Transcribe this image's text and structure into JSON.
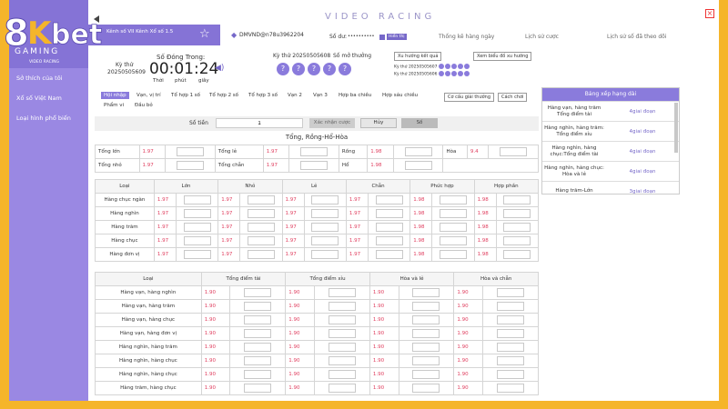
{
  "brand": {
    "logo_text": "8Kbet",
    "title": "VIDEO RACING"
  },
  "sidebar": {
    "game_label": "GAMING",
    "sub": "VIDEO RACING",
    "items": [
      "Sở thích của tôi",
      "Xổ số Việt Nam",
      "Loại hình phổ biến"
    ]
  },
  "header": {
    "breadcrumb": "Kênh số    VII Kênh Xổ số 1.5",
    "account": "DMVND@n78u3962204",
    "balance_label": "Số dư:",
    "balance_value": "••••••••••",
    "show_label": "Hiển thị",
    "links": [
      "Thống kê hàng ngày",
      "Lịch sử cược",
      "Lịch sử số đã theo dõi"
    ]
  },
  "draw": {
    "period_label": "Kỳ thứ",
    "period": "20250505609",
    "closing_label": "Số Đóng Trong:",
    "timer": "00:01:24",
    "units": [
      "Thời",
      "phút",
      "giây"
    ],
    "last_period_label": "Kỳ thứ 20250505608",
    "result_label": "Số mở thưởng",
    "balls": [
      "?",
      "?",
      "?",
      "?",
      "?"
    ],
    "trend_btn": "Xu hướng kết quả",
    "chart_btn": "Xem biểu đồ xu hướng",
    "hist1": "Kỳ thứ 20250505607",
    "hist2": "Kỳ thứ 20250505606"
  },
  "tabs": [
    "Hội nhập",
    "Vạn, vị trí",
    "Tổ hợp 1 số",
    "Tổ hợp 2 số",
    "Tổ hợp 3 số",
    "Vạn 2",
    "Vạn 3",
    "Hợp ba chiều",
    "Hợp sáu chiều",
    "Phẩm vi",
    "Đầu bỏ"
  ],
  "rule_buttons": [
    "Cơ cấu giải thưởng",
    "Cách chơi"
  ],
  "bet": {
    "amount_label": "Số tiền",
    "amount": "1",
    "confirm": "Xác nhận cược",
    "cancel": "Hủy",
    "num": "Số"
  },
  "sec1": {
    "title": "Tổng, Rồng-Hổ-Hòa",
    "rows": [
      [
        {
          "l": "Tổng lớn",
          "o": "1.97"
        },
        {
          "l": "Tổng lẻ",
          "o": "1.97"
        },
        {
          "l": "Rồng",
          "o": "1.98"
        },
        {
          "l": "Hòa",
          "o": "9.4"
        }
      ],
      [
        {
          "l": "Tổng nhỏ",
          "o": "1.97"
        },
        {
          "l": "Tổng chẵn",
          "o": "1.97"
        },
        {
          "l": "Hổ",
          "o": "1.98"
        }
      ]
    ]
  },
  "sec2": {
    "headers": [
      "Loại",
      "Lớn",
      "Nhỏ",
      "Lẻ",
      "Chẵn",
      "Phức hợp",
      "Hợp phần"
    ],
    "rows": [
      {
        "n": "Hàng chục ngàn",
        "o": [
          "1.97",
          "1.97",
          "1.97",
          "1.97",
          "1.98",
          "1.98"
        ]
      },
      {
        "n": "Hàng nghìn",
        "o": [
          "1.97",
          "1.97",
          "1.97",
          "1.97",
          "1.98",
          "1.98"
        ]
      },
      {
        "n": "Hàng trăm",
        "o": [
          "1.97",
          "1.97",
          "1.97",
          "1.97",
          "1.98",
          "1.98"
        ]
      },
      {
        "n": "Hàng chục",
        "o": [
          "1.97",
          "1.97",
          "1.97",
          "1.97",
          "1.98",
          "1.98"
        ]
      },
      {
        "n": "Hàng đơn vị",
        "o": [
          "1.97",
          "1.97",
          "1.97",
          "1.97",
          "1.98",
          "1.98"
        ]
      }
    ]
  },
  "sec3": {
    "headers": [
      "Loại",
      "Tổng điểm tài",
      "Tổng điểm xỉu",
      "Hòa và lẻ",
      "Hòa và chẵn"
    ],
    "rows": [
      {
        "n": "Hàng vạn, hàng nghìn",
        "o": [
          "1.90",
          "1.90",
          "1.90",
          "1.90"
        ]
      },
      {
        "n": "Hàng vạn, hàng trăm",
        "o": [
          "1.90",
          "1.90",
          "1.90",
          "1.90"
        ]
      },
      {
        "n": "Hàng vạn, hàng chục",
        "o": [
          "1.90",
          "1.90",
          "1.90",
          "1.90"
        ]
      },
      {
        "n": "Hàng vạn, hàng đơn vị",
        "o": [
          "1.90",
          "1.90",
          "1.90",
          "1.90"
        ]
      },
      {
        "n": "Hàng nghìn, hàng trăm",
        "o": [
          "1.90",
          "1.90",
          "1.90",
          "1.90"
        ]
      },
      {
        "n": "Hàng nghìn, hàng chục",
        "o": [
          "1.90",
          "1.90",
          "1.90",
          "1.90"
        ]
      },
      {
        "n": "Hàng nghìn, hàng chục",
        "o": [
          "1.90",
          "1.90",
          "1.90",
          "1.90"
        ]
      },
      {
        "n": "Hàng trăm, hàng chục",
        "o": [
          "1.90",
          "1.90",
          "1.90",
          "1.90"
        ]
      }
    ]
  },
  "panel": {
    "title": "Bảng xếp hạng dài",
    "rows": [
      {
        "n": "Hàng vạn, hàng trăm Tổng điểm tài",
        "v": "4giai đoạn"
      },
      {
        "n": "Hàng nghìn, hàng trăm: Tổng điểm xỉu",
        "v": "4giai đoạn"
      },
      {
        "n": "Hàng nghìn, hàng chục:Tổng điểm tài",
        "v": "4giai đoạn"
      },
      {
        "n": "Hàng nghìn, hàng chục: Hòa và lẻ",
        "v": "4giai đoạn"
      },
      {
        "n": "Hàng trăm-Lớn",
        "v": "3giai đoạn"
      }
    ]
  }
}
